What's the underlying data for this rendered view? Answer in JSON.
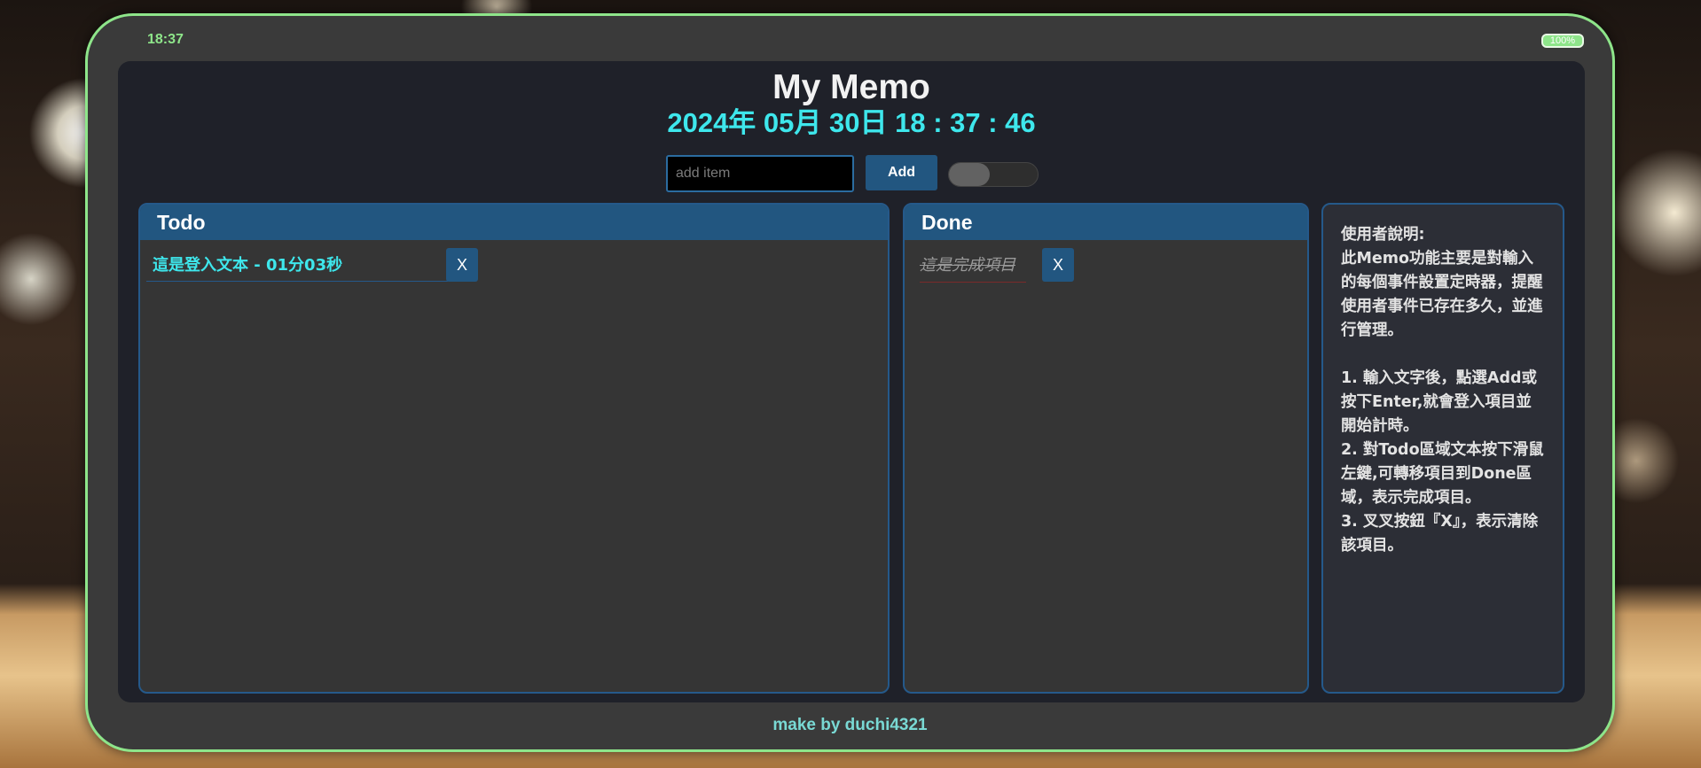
{
  "status_bar": {
    "time": "18:37",
    "battery": "100%"
  },
  "app": {
    "title": "My Memo",
    "clock": "2024年 05月 30日 18 : 37 : 46"
  },
  "controls": {
    "input_placeholder": "add item",
    "input_value": "",
    "add_label": "Add",
    "toggle_on": false
  },
  "todo": {
    "title": "Todo",
    "items": [
      {
        "text": "這是登入文本 - 01分03秒",
        "delete_label": "X"
      }
    ]
  },
  "done": {
    "title": "Done",
    "items": [
      {
        "text": "這是完成項目",
        "delete_label": "X"
      }
    ]
  },
  "help": {
    "text": "使用者說明:\n此Memo功能主要是對輸入的每個事件設置定時器，提醒使用者事件已存在多久，並進行管理。\n\n1. 輸入文字後，點選Add或按下Enter,就會登入項目並開始計時。\n2. 對Todo區域文本按下滑鼠左鍵,可轉移項目到Done區域，表示完成項目。\n3. 叉叉按鈕『X』，表示清除該項目。"
  },
  "footer": {
    "text": "make by duchi4321"
  },
  "colors": {
    "frame_border": "#8ee58a",
    "accent_blue": "#225680",
    "cyan_text": "#3ee7ec",
    "screen_bg": "#1f2129"
  }
}
